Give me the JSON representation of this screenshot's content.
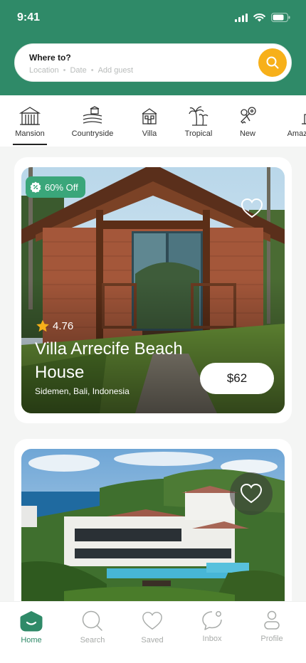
{
  "status": {
    "time": "9:41"
  },
  "search": {
    "title": "Where to?",
    "location": "Location",
    "date": "Date",
    "guest": "Add guest",
    "sep": "•"
  },
  "categories": [
    {
      "label": "Mansion",
      "icon": "mansion-icon"
    },
    {
      "label": "Countryside",
      "icon": "countryside-icon"
    },
    {
      "label": "Villa",
      "icon": "villa-icon"
    },
    {
      "label": "Tropical",
      "icon": "palm-tree-icon"
    },
    {
      "label": "New",
      "icon": "keys-icon"
    },
    {
      "label": "Amazing",
      "icon": "house-icon"
    }
  ],
  "listings": [
    {
      "discount": "60% Off",
      "rating": "4.76",
      "title": "Villa Arrecife Beach House",
      "location": "Sidemen, Bali, Indonesia",
      "price": "$62"
    }
  ],
  "nav": [
    {
      "label": "Home",
      "icon": "home-icon"
    },
    {
      "label": "Search",
      "icon": "search-icon"
    },
    {
      "label": "Saved",
      "icon": "heart-icon"
    },
    {
      "label": "Inbox",
      "icon": "chat-icon"
    },
    {
      "label": "Profile",
      "icon": "profile-icon"
    }
  ],
  "colors": {
    "brand": "#2f8a68",
    "accent": "#f7b01a",
    "badge": "#3aa67a"
  }
}
